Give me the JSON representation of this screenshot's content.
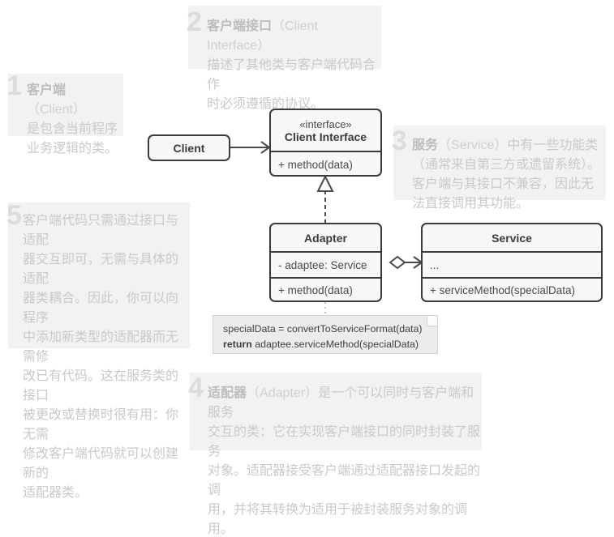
{
  "diagram": {
    "title": "Adapter Pattern UML Structure",
    "palette": {
      "page_bg": "#ffffff",
      "note_bg": "#f2f2f2",
      "note_text": "#c9c9c9",
      "note_number": "#dcdcdc",
      "box_border": "#3b3b3b",
      "box_fill": "#f7f7f7",
      "code_note_bg": "#ececec",
      "connector": "#4a4a4a"
    }
  },
  "notes": [
    {
      "number": "1",
      "term": "客户端",
      "term_en": "（Client）",
      "body": "是包含当前程序\n业务逻辑的类。"
    },
    {
      "number": "2",
      "term": "客户端接口",
      "term_en": "（Client Interface）",
      "body": "描述了其他类与客户端代码合作\n时必须遵循的协议。"
    },
    {
      "number": "3",
      "term": "服务",
      "term_en": "（Service）",
      "body": "中有一些功能类\n（通常来自第三方或遗留系统）。\n客户端与其接口不兼容，因此无\n法直接调用其功能。"
    },
    {
      "number": "4",
      "term": "适配器",
      "term_en": "（Adapter）",
      "body": "是一个可以同时与客户端和服务\n交互的类：它在实现客户端接口的同时封装了服务\n对象。适配器接受客户端通过适配器接口发起的调\n用，并将其转换为适用于被封装服务对象的调用。"
    },
    {
      "number": "5",
      "term": "",
      "term_en": "",
      "body": "客户端代码只需通过接口与适配\n器交互即可，无需与具体的适配\n器类耦合。因此，你可以向程序\n中添加新类型的适配器而无需修\n改已有代码。这在服务类的接口\n被更改或替换时很有用：你无需\n修改客户端代码就可以创建新的\n适配器类。"
    }
  ],
  "classes": {
    "client": {
      "name": "Client"
    },
    "client_interface": {
      "stereotype": "«interface»",
      "name": "Client Interface",
      "members": [
        "+ method(data)"
      ]
    },
    "adapter": {
      "name": "Adapter",
      "fields": [
        "- adaptee: Service"
      ],
      "methods": [
        "+ method(data)"
      ]
    },
    "service": {
      "name": "Service",
      "fields": [
        "..."
      ],
      "methods": [
        "+ serviceMethod(specialData)"
      ]
    }
  },
  "code_note": {
    "line1": "specialData = convertToServiceFormat(data)",
    "line2_keyword": "return",
    "line2_rest": " adaptee.serviceMethod(specialData)"
  },
  "relations": [
    {
      "name": "client-uses-interface",
      "type": "association-arrow",
      "from": "Client",
      "to": "Client Interface"
    },
    {
      "name": "adapter-implements-interface",
      "type": "realization-dashed-hollow-triangle",
      "from": "Adapter",
      "to": "Client Interface"
    },
    {
      "name": "adapter-aggregates-service",
      "type": "aggregation-hollow-diamond-arrow",
      "from": "Adapter",
      "to": "Service"
    },
    {
      "name": "adapter-method-code-link",
      "type": "note-link-dotted",
      "from": "Adapter",
      "to": "code note"
    }
  ]
}
